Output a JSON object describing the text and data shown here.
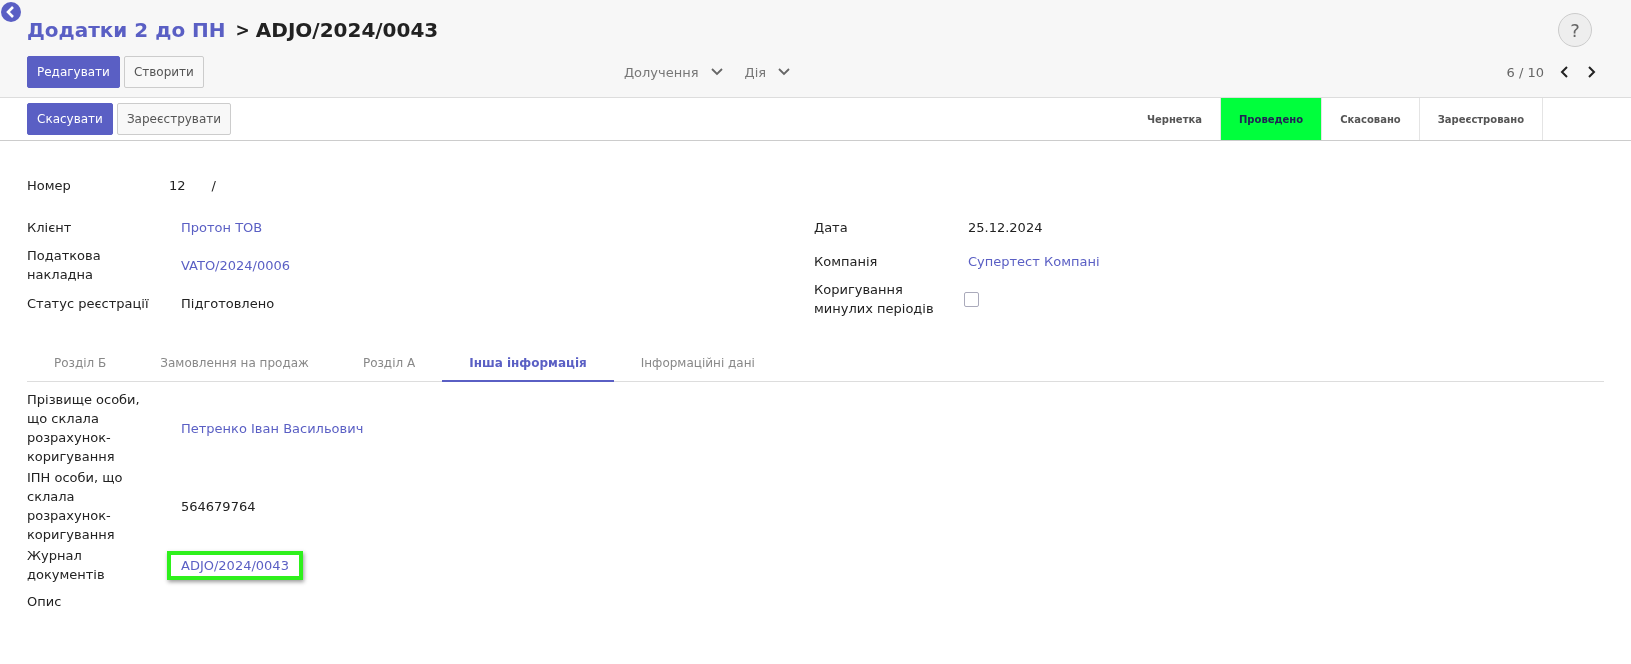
{
  "breadcrumb": {
    "parent": "Додатки 2 до ПН",
    "separator": ">",
    "current": "ADJO/2024/0043"
  },
  "help": {
    "label": "?"
  },
  "toolbar": {
    "buttons": [
      {
        "label": "Редагувати",
        "primary": true
      },
      {
        "label": "Створити",
        "primary": false
      }
    ],
    "menus": [
      {
        "label": "Долучення"
      },
      {
        "label": "Дія"
      }
    ],
    "pager": "6 / 10"
  },
  "statusbar": {
    "buttons": [
      {
        "label": "Скасувати",
        "primary": true
      },
      {
        "label": "Зареєструвати",
        "primary": false
      }
    ],
    "stages": [
      {
        "label": "Чернетка",
        "selected": false
      },
      {
        "label": "Проведено",
        "selected": true
      },
      {
        "label": "Скасовано",
        "selected": false
      },
      {
        "label": "Зареєстровано",
        "selected": false
      }
    ]
  },
  "number": {
    "label": "Номер",
    "value": "12",
    "suffix": "/"
  },
  "left_fields": [
    {
      "label": "Клієнт",
      "kind": "link",
      "value": "Протон ТОВ"
    },
    {
      "label": "Податкова накладна",
      "kind": "link",
      "value": "VATO/2024/0006"
    },
    {
      "label": "Статус реєстрації",
      "kind": "text",
      "value": "Підготовлено"
    }
  ],
  "right_fields": [
    {
      "label": "Дата",
      "kind": "text",
      "value": "25.12.2024"
    },
    {
      "label": "Компанія",
      "kind": "link",
      "value": "Супертест Компані"
    },
    {
      "label": "Коригування минулих періодів",
      "kind": "checkbox",
      "checked": false
    }
  ],
  "tabs": [
    {
      "label": "Розділ Б",
      "selected": false
    },
    {
      "label": "Замовлення на продаж",
      "selected": false
    },
    {
      "label": "Розділ А",
      "selected": false
    },
    {
      "label": "Інша інформація",
      "selected": true
    },
    {
      "label": "Інформаційні дані",
      "selected": false
    }
  ],
  "tab_fields": [
    {
      "label": "Прізвище особи, що склала розрахунок-коригування",
      "kind": "link",
      "value": "Петренко Іван Васильович",
      "highlighted": false
    },
    {
      "label": "ІПН особи, що склала розрахунок-коригування",
      "kind": "text",
      "value": "564679764",
      "highlighted": false
    },
    {
      "label": "Журнал документів",
      "kind": "link",
      "value": "ADJO/2024/0043",
      "highlighted": true
    },
    {
      "label": "Опис",
      "kind": "empty"
    }
  ]
}
